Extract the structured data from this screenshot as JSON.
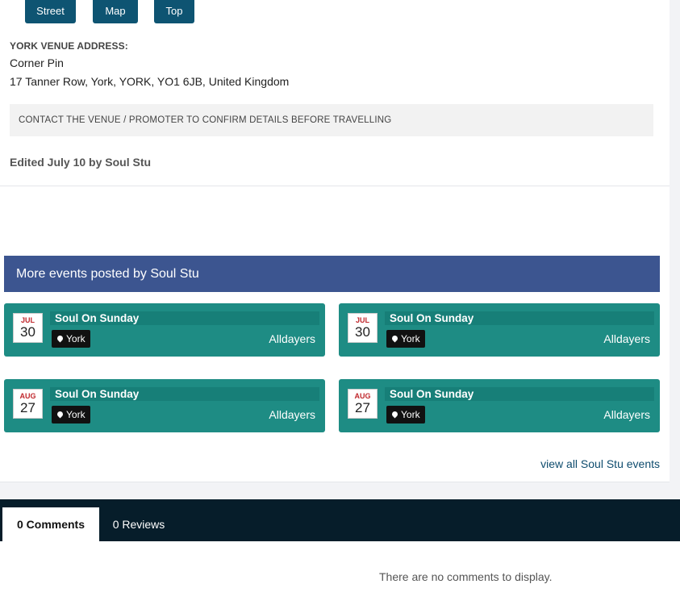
{
  "nav_buttons": [
    "Street",
    "Map",
    "Top"
  ],
  "venue": {
    "label": "YORK VENUE ADDRESS:",
    "name": "Corner Pin",
    "address": "17 Tanner Row, York, YORK, YO1 6JB, United Kingdom"
  },
  "notice": "CONTACT THE VENUE / PROMOTER TO CONFIRM DETAILS BEFORE TRAVELLING",
  "edited": "Edited July 10 by Soul Stu",
  "more_events": {
    "header": "More events posted by Soul Stu",
    "events": [
      {
        "month": "JUL",
        "day": "30",
        "title": "Soul On Sunday",
        "location": "York",
        "category": "Alldayers"
      },
      {
        "month": "JUL",
        "day": "30",
        "title": "Soul On Sunday",
        "location": "York",
        "category": "Alldayers"
      },
      {
        "month": "AUG",
        "day": "27",
        "title": "Soul On Sunday",
        "location": "York",
        "category": "Alldayers"
      },
      {
        "month": "AUG",
        "day": "27",
        "title": "Soul On Sunday",
        "location": "York",
        "category": "Alldayers"
      }
    ],
    "view_all": "view all Soul Stu events"
  },
  "comments": {
    "tabs": [
      "0 Comments",
      "0 Reviews"
    ],
    "empty_text": "There are no comments to display."
  },
  "colors": {
    "nav_button": "#0e5472",
    "header": "#3c5590",
    "event_card": "#1e8c84",
    "comments_bar": "#061d2a"
  },
  "icons": {
    "location": "map-pin-icon"
  }
}
